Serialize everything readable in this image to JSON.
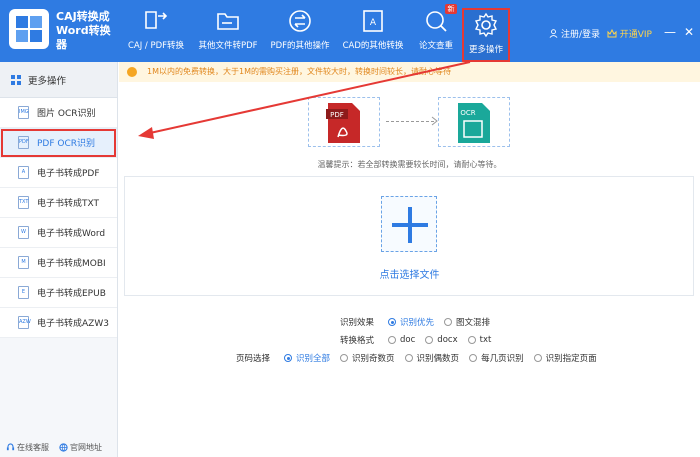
{
  "app": {
    "title_line1": "CAJ转换成",
    "title_line2": "Word转换器"
  },
  "toolbar": [
    {
      "name": "caj-pdf",
      "label": "CAJ / PDF转换"
    },
    {
      "name": "other-to-pdf",
      "label": "其他文件转PDF"
    },
    {
      "name": "pdf-other",
      "label": "PDF的其他操作"
    },
    {
      "name": "cad-other",
      "label": "CAD的其他转换"
    },
    {
      "name": "paper-check",
      "label": "论文查重"
    },
    {
      "name": "more-ops",
      "label": "更多操作"
    }
  ],
  "badge": "新",
  "user": {
    "login_label": "注册/登录",
    "vip_label": "开通VIP"
  },
  "sidebar": {
    "head": "更多操作",
    "items": [
      {
        "label": "图片 OCR识别",
        "icon": "IMG"
      },
      {
        "label": "PDF OCR识别",
        "icon": "PDF"
      },
      {
        "label": "电子书转成PDF",
        "icon": "A"
      },
      {
        "label": "电子书转成TXT",
        "icon": "TXT"
      },
      {
        "label": "电子书转成Word",
        "icon": "W"
      },
      {
        "label": "电子书转成MOBI",
        "icon": "M"
      },
      {
        "label": "电子书转成EPUB",
        "icon": "E"
      },
      {
        "label": "电子书转成AZW3",
        "icon": "AZW"
      }
    ],
    "footer": {
      "service": "在线客服",
      "website": "官网地址"
    }
  },
  "notice": "1M以内的免费转换，大于1M的需购买注册，文件较大时，转换时间较长，请耐心等待",
  "convert": {
    "from_label": "PDF",
    "to_label": "OCR"
  },
  "tip": "温馨提示：若全部转换需要较长时间，请耐心等待。",
  "choose_file": "点击选择文件",
  "options": {
    "recognize": {
      "label": "识别效果",
      "choices": [
        "识别优先",
        "图文混排"
      ],
      "selected": 0
    },
    "format": {
      "label": "转换格式",
      "choices": [
        "doc",
        "docx",
        "txt"
      ],
      "selected": -1
    },
    "pages": {
      "label": "页码选择",
      "choices": [
        "识别全部",
        "识别奇数页",
        "识别偶数页",
        "每几页识别",
        "识别指定页面"
      ],
      "selected": 0
    }
  },
  "colors": {
    "primary": "#2f7be2",
    "highlight": "#e53935",
    "notice_text": "#e0861c"
  }
}
